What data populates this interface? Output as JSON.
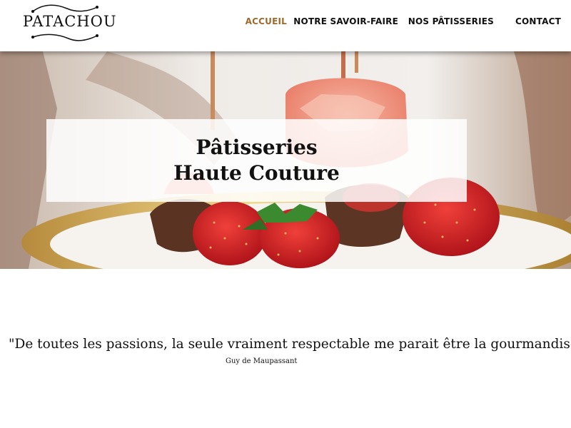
{
  "brand": {
    "name": "PATACHOU",
    "accent_color": "#9c6a2d"
  },
  "nav": {
    "items": [
      {
        "label": "ACCUEIL",
        "active": true
      },
      {
        "label": "NOTRE SAVOIR-FAIRE",
        "active": false
      },
      {
        "label": "NOS PÂTISSERIES",
        "active": false
      },
      {
        "label": "CONTACT",
        "active": false
      }
    ]
  },
  "hero": {
    "title_line1": "Pâtisseries",
    "title_line2": "Haute Couture",
    "image_subject": "strawberry-pastries-on-gold-plate"
  },
  "quote": {
    "text": "\"De toutes les passions, la seule vraiment respectable me parait être la gourmandise.\"",
    "author": "Guy de Maupassant"
  }
}
